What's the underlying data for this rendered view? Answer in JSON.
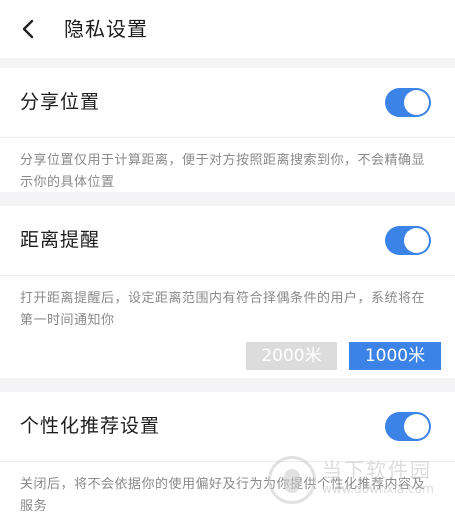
{
  "header": {
    "title": "隐私设置"
  },
  "share_location": {
    "label": "分享位置",
    "enabled": true,
    "description": "分享位置仅用于计算距离，便于对方按照距离搜索到你，不会精确显示你的具体位置"
  },
  "distance_reminder": {
    "label": "距离提醒",
    "enabled": true,
    "description": "打开距离提醒后，设定距离范围内有符合择偶条件的用户，系统将在第一时间通知你",
    "options": [
      "2000米",
      "1000米"
    ],
    "selected": "1000米"
  },
  "personalized_recommend": {
    "label": "个性化推荐设置",
    "enabled": true,
    "description": "关闭后，将不会依据你的使用偏好及行为为你提供个性化推荐内容及服务"
  },
  "watermark": {
    "title": "当下软件园",
    "url": "www.downxia.com"
  },
  "colors": {
    "accent": "#3b83e6",
    "inactive": "#dcdcdc",
    "background": "#f4f4f6"
  },
  "icons": {
    "back": "chevron-left-icon"
  }
}
